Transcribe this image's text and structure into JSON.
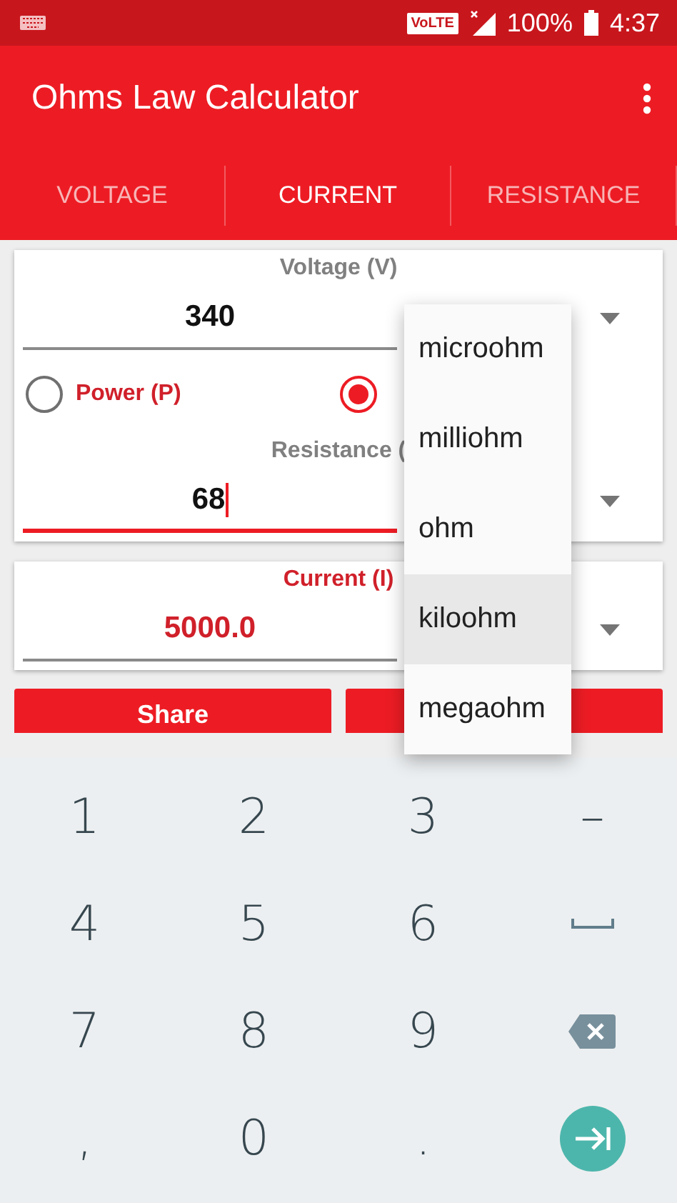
{
  "status_bar": {
    "network_badge": "VoLTE",
    "battery": "100%",
    "time": "4:37"
  },
  "app_bar": {
    "title": "Ohms Law Calculator"
  },
  "tabs": [
    {
      "label": "VOLTAGE",
      "selected": false
    },
    {
      "label": "CURRENT",
      "selected": true
    },
    {
      "label": "RESISTANCE",
      "selected": false
    }
  ],
  "input_card": {
    "voltage": {
      "label": "Voltage (V)",
      "value": "340",
      "focused": false
    },
    "radios": [
      {
        "label": "Power (P)",
        "selected": false
      },
      {
        "selected": true
      }
    ],
    "resistance": {
      "label": "Resistance (",
      "value": "68",
      "focused": true
    }
  },
  "result_card": {
    "label": "Current (I)",
    "value": "5000.0"
  },
  "buttons": [
    {
      "kind": "labeled",
      "label": "Share"
    },
    {
      "kind": "covered"
    }
  ],
  "unit_menu": [
    {
      "label": "microohm",
      "selected": false
    },
    {
      "label": "milliohm",
      "selected": false
    },
    {
      "label": "ohm",
      "selected": false
    },
    {
      "label": "kiloohm",
      "selected": true
    },
    {
      "label": "megaohm",
      "selected": false
    }
  ],
  "keyboard": [
    {
      "kind": "char",
      "label": "1"
    },
    {
      "kind": "char",
      "label": "2"
    },
    {
      "kind": "char",
      "label": "3"
    },
    {
      "kind": "char",
      "label": "–"
    },
    {
      "kind": "char",
      "label": "4"
    },
    {
      "kind": "char",
      "label": "5"
    },
    {
      "kind": "char",
      "label": "6"
    },
    {
      "kind": "space"
    },
    {
      "kind": "char",
      "label": "7"
    },
    {
      "kind": "char",
      "label": "8"
    },
    {
      "kind": "char",
      "label": "9"
    },
    {
      "kind": "backspace"
    },
    {
      "kind": "char",
      "label": ","
    },
    {
      "kind": "char",
      "label": "0"
    },
    {
      "kind": "char",
      "label": "."
    },
    {
      "kind": "enter"
    }
  ]
}
